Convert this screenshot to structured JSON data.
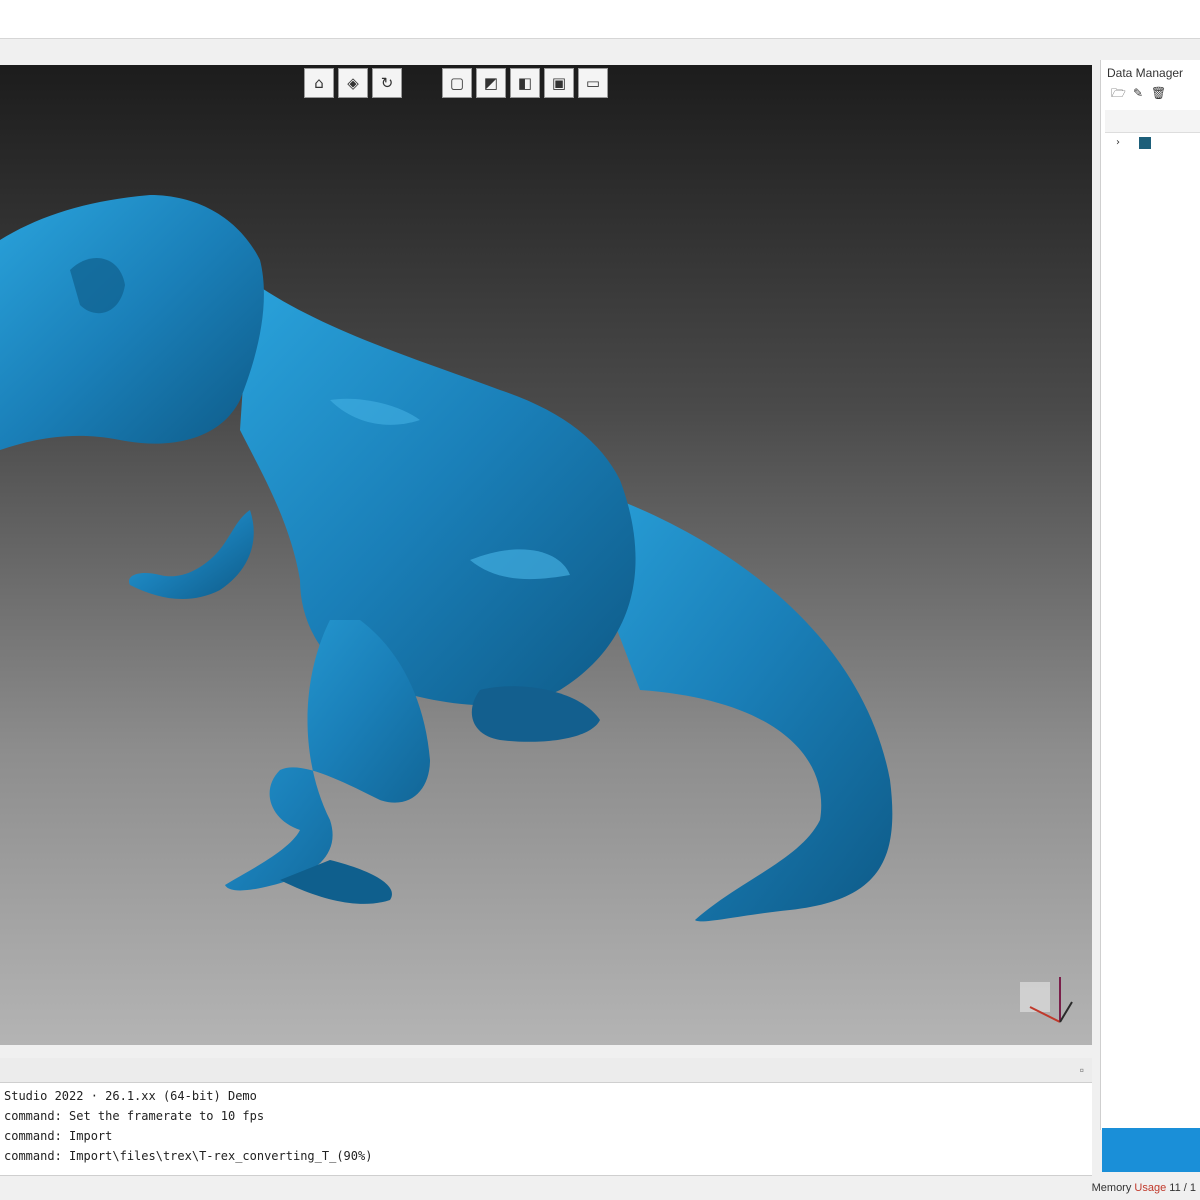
{
  "window": {
    "title": ""
  },
  "toolbar": {
    "left_icons": [
      "home-icon",
      "fit-view-icon",
      "rotate-icon"
    ],
    "left_glyphs": [
      "⌂",
      "◈",
      "↻"
    ],
    "right_icons": [
      "front-view-icon",
      "top-view-icon",
      "side-view-icon",
      "perspective-icon",
      "ortho-icon"
    ],
    "right_glyphs": [
      "▢",
      "◩",
      "◧",
      "▣",
      "▭"
    ]
  },
  "panel": {
    "title": "Data Manager",
    "icon_glyphs": [
      "🗁",
      "✎",
      "🗑"
    ]
  },
  "console": {
    "lines": [
      "Studio 2022 · 26.1.xx (64-bit) Demo",
      "command: Set the framerate to 10 fps",
      "command: Import",
      "command: Import\\files\\trex\\T-rex_converting_T_(90%)"
    ]
  },
  "status": {
    "label": "Memory",
    "highlight": "Usage",
    "value": "11 / 1"
  },
  "colors": {
    "model": "#1a7fb8",
    "accent": "#1a8fd8"
  }
}
